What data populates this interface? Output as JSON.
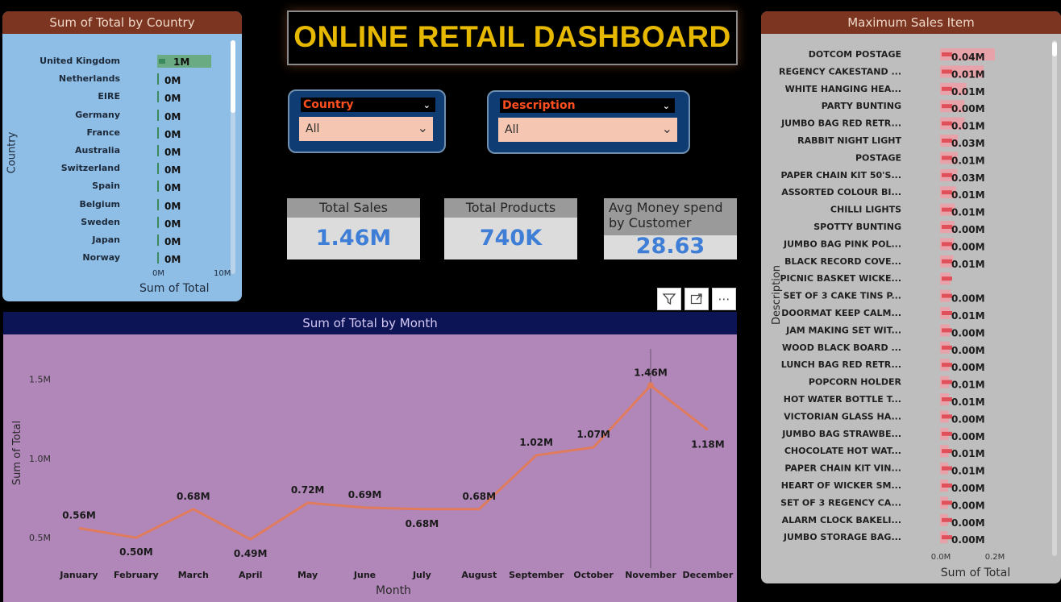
{
  "country_chart": {
    "title": "Sum of Total by Country",
    "ylabel": "Country",
    "xlabel": "Sum of Total",
    "x_ticks": [
      "0M",
      "10M"
    ],
    "rows": [
      {
        "country": "United Kingdom",
        "label": "1M",
        "value": 1.2
      },
      {
        "country": "Netherlands",
        "label": "0M",
        "value": 0.03
      },
      {
        "country": "EIRE",
        "label": "0M",
        "value": 0.03
      },
      {
        "country": "Germany",
        "label": "0M",
        "value": 0.02
      },
      {
        "country": "France",
        "label": "0M",
        "value": 0.02
      },
      {
        "country": "Australia",
        "label": "0M",
        "value": 0.01
      },
      {
        "country": "Switzerland",
        "label": "0M",
        "value": 0.01
      },
      {
        "country": "Spain",
        "label": "0M",
        "value": 0.01
      },
      {
        "country": "Belgium",
        "label": "0M",
        "value": 0.01
      },
      {
        "country": "Sweden",
        "label": "0M",
        "value": 0.01
      },
      {
        "country": "Japan",
        "label": "0M",
        "value": 0.01
      },
      {
        "country": "Norway",
        "label": "0M",
        "value": 0.01
      }
    ]
  },
  "title": "ONLINE RETAIL DASHBOARD",
  "slicers": {
    "country": {
      "title": "Country",
      "value": "All"
    },
    "description": {
      "title": "Description",
      "value": "All"
    }
  },
  "kpis": {
    "total_sales": {
      "label": "Total Sales",
      "value": "1.46M"
    },
    "total_products": {
      "label": "Total Products",
      "value": "740K"
    },
    "avg_spend": {
      "label_line1": "Avg Money spend",
      "label_line2": "by Customer",
      "value": "28.63"
    }
  },
  "toolbar": {
    "filter_icon": "filter-icon",
    "focus_icon": "focus-mode-icon",
    "more_icon": "more-options-icon",
    "more_label": "⋯"
  },
  "chart_data": [
    {
      "type": "line",
      "title": "Sum of Total by Month",
      "xlabel": "Month",
      "ylabel": "Sum of Total",
      "y_ticks": [
        "0.5M",
        "1.0M",
        "1.5M"
      ],
      "ylim": [
        0.44,
        1.64
      ],
      "categories": [
        "January",
        "February",
        "March",
        "April",
        "May",
        "June",
        "July",
        "August",
        "September",
        "October",
        "November",
        "December"
      ],
      "values": [
        0.56,
        0.5,
        0.68,
        0.49,
        0.72,
        0.69,
        0.68,
        0.68,
        1.02,
        1.07,
        1.46,
        1.18
      ],
      "labels": [
        "0.56M",
        "0.50M",
        "0.68M",
        "0.49M",
        "0.72M",
        "0.69M",
        "0.68M",
        "0.68M",
        "1.02M",
        "1.07M",
        "1.46M",
        "1.18M"
      ],
      "highlight": "November",
      "line_color": "#e07b5c"
    },
    {
      "type": "bar",
      "title": "Maximum Sales Item",
      "xlabel": "Sum of Total",
      "ylabel": "Description",
      "x_ticks": [
        "0.0M",
        "0.2M"
      ],
      "xlim": [
        0,
        0.2
      ],
      "categories": [
        "DOTCOM POSTAGE",
        "REGENCY CAKESTAND ...",
        "WHITE HANGING HEA...",
        "PARTY BUNTING",
        "JUMBO BAG RED RETR...",
        "RABBIT NIGHT LIGHT",
        "POSTAGE",
        "PAPER CHAIN KIT 50'S...",
        "ASSORTED COLOUR BI...",
        "CHILLI LIGHTS",
        "SPOTTY BUNTING",
        "JUMBO BAG PINK POL...",
        "BLACK RECORD COVE...",
        "PICNIC BASKET WICKE...",
        "SET OF 3 CAKE TINS P...",
        "DOORMAT KEEP CALM...",
        "JAM MAKING SET WIT...",
        "WOOD BLACK BOARD ...",
        "LUNCH BAG RED RETR...",
        "POPCORN HOLDER",
        "HOT WATER BOTTLE T...",
        "VICTORIAN GLASS HA...",
        "JUMBO BAG STRAWBE...",
        "CHOCOLATE HOT WAT...",
        "PAPER CHAIN KIT VIN...",
        "HEART OF WICKER SM...",
        "SET OF 3 REGENCY CA...",
        "ALARM CLOCK BAKELI...",
        "JUMBO STORAGE BAG..."
      ],
      "values": [
        0.206,
        0.164,
        0.099,
        0.092,
        0.092,
        0.067,
        0.066,
        0.065,
        0.06,
        0.056,
        0.054,
        0.052,
        0.05,
        0.039,
        0.039,
        0.038,
        0.037,
        0.036,
        0.035,
        0.034,
        0.033,
        0.033,
        0.032,
        0.032,
        0.031,
        0.03,
        0.03,
        0.029,
        0.028
      ],
      "labels": [
        "0.04M",
        "0.01M",
        "0.01M",
        "0.00M",
        "0.01M",
        "0.03M",
        "0.01M",
        "0.03M",
        "0.01M",
        "0.01M",
        "0.00M",
        "0.00M",
        "0.01M",
        "",
        "0.00M",
        "0.01M",
        "0.00M",
        "0.00M",
        "0.00M",
        "0.01M",
        "0.01M",
        "0.00M",
        "0.00M",
        "0.01M",
        "0.01M",
        "0.00M",
        "0.00M",
        "0.00M",
        "0.00M"
      ],
      "bar_color": "#e8a3aa",
      "marker_color": "#e0505b"
    }
  ]
}
